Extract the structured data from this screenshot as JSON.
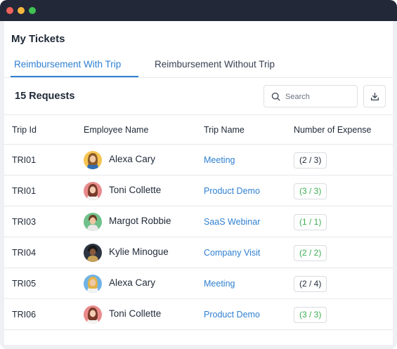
{
  "page": {
    "title": "My Tickets"
  },
  "tabs": [
    {
      "label": "Reimbursement With Trip",
      "active": true
    },
    {
      "label": "Reimbursement Without Trip",
      "active": false
    }
  ],
  "toolbar": {
    "request_count": "15 Requests",
    "search_placeholder": "Search",
    "search_icon": "search-icon",
    "download_icon": "download-icon"
  },
  "table": {
    "headers": [
      "Trip Id",
      "Employee Name",
      "Trip Name",
      "Number of Expense"
    ],
    "rows": [
      {
        "trip_id": "TRI01",
        "employee": "Alexa Cary",
        "trip_name": "Meeting",
        "expense": "(2 / 3)",
        "status": "incomplete"
      },
      {
        "trip_id": "TRI01",
        "employee": "Toni Collette",
        "trip_name": "Product Demo",
        "expense": "(3 / 3)",
        "status": "complete"
      },
      {
        "trip_id": "TRI03",
        "employee": "Margot Robbie",
        "trip_name": "SaaS Webinar",
        "expense": "(1 / 1)",
        "status": "complete"
      },
      {
        "trip_id": "TRI04",
        "employee": "Kylie Minogue",
        "trip_name": "Company Visit",
        "expense": "(2 / 2)",
        "status": "complete"
      },
      {
        "trip_id": "TRI05",
        "employee": "Alexa Cary",
        "trip_name": "Meeting",
        "expense": "(2 / 4)",
        "status": "incomplete"
      },
      {
        "trip_id": "TRI06",
        "employee": "Toni Collette",
        "trip_name": "Product Demo",
        "expense": "(3 / 3)",
        "status": "complete"
      }
    ]
  },
  "colors": {
    "accent": "#2f80d1",
    "complete": "#3aad4f",
    "titlebar": "#232838"
  }
}
